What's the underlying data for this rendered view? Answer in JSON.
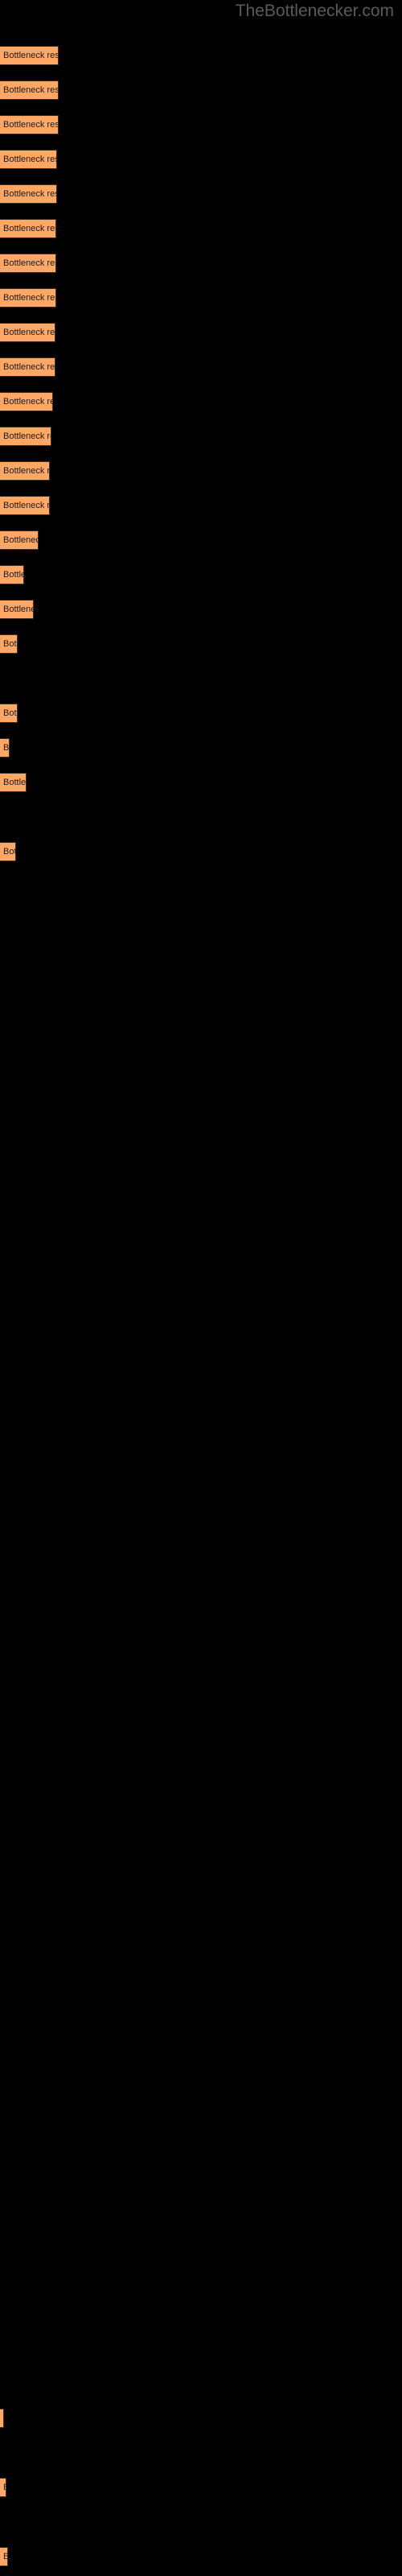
{
  "watermark": "TheBottlenecker.com",
  "colors": {
    "background": "#000000",
    "bar_fill": "#ffa866",
    "bar_border": "#3d2b1e",
    "label_text": "#1a1a1a",
    "watermark_text": "#5a5a5a"
  },
  "chart_data": {
    "type": "bar",
    "orientation": "horizontal",
    "title": "",
    "subtitle": "",
    "xlabel": "",
    "ylabel": "",
    "grid": false,
    "legend": null,
    "bar_label_text": "Bottleneck result",
    "categories": [
      "Bottleneck result",
      "Bottleneck result",
      "Bottleneck result",
      "Bottleneck result",
      "Bottleneck result",
      "Bottleneck result",
      "Bottleneck result",
      "Bottleneck result",
      "Bottleneck result",
      "Bottleneck result",
      "Bottleneck result",
      "Bottleneck result",
      "Bottleneck result",
      "Bottleneck result",
      "Bottleneck result",
      "Bottleneck result",
      "Bottleneck result",
      "Bottleneck result",
      "Bottleneck result",
      "Bottleneck result",
      "Bottleneck result",
      "Bottleneck result",
      "Bottleneck result",
      "Bottleneck result",
      "Bottleneck result",
      "Bottleneck result"
    ],
    "values": [
      73,
      73,
      73,
      71,
      71,
      70,
      70,
      70,
      69,
      69,
      66,
      64,
      62,
      62,
      48,
      30,
      42,
      22,
      22,
      18,
      33,
      20,
      5,
      5,
      5,
      10
    ],
    "xlim": [
      0,
      500
    ],
    "bars": [
      {
        "index": 1,
        "y": 57,
        "width": 73,
        "height": 24,
        "label": "Bottleneck result"
      },
      {
        "index": 2,
        "y": 100,
        "width": 73,
        "height": 24,
        "label": "Bottleneck result"
      },
      {
        "index": 3,
        "y": 143,
        "width": 73,
        "height": 24,
        "label": "Bottleneck result"
      },
      {
        "index": 4,
        "y": 186,
        "width": 71,
        "height": 24,
        "label": "Bottleneck result"
      },
      {
        "index": 5,
        "y": 229,
        "width": 71,
        "height": 24,
        "label": "Bottleneck result"
      },
      {
        "index": 6,
        "y": 272,
        "width": 70,
        "height": 24,
        "label": "Bottleneck resul"
      },
      {
        "index": 7,
        "y": 315,
        "width": 70,
        "height": 24,
        "label": "Bottleneck resul"
      },
      {
        "index": 8,
        "y": 358,
        "width": 70,
        "height": 24,
        "label": "Bottleneck resul"
      },
      {
        "index": 9,
        "y": 401,
        "width": 69,
        "height": 24,
        "label": "Bottleneck resul"
      },
      {
        "index": 10,
        "y": 444,
        "width": 69,
        "height": 24,
        "label": "Bottleneck resu"
      },
      {
        "index": 11,
        "y": 487,
        "width": 66,
        "height": 24,
        "label": "Bottleneck resu"
      },
      {
        "index": 12,
        "y": 530,
        "width": 64,
        "height": 24,
        "label": "Bottleneck res"
      },
      {
        "index": 13,
        "y": 573,
        "width": 62,
        "height": 24,
        "label": "Bottleneck res"
      },
      {
        "index": 14,
        "y": 616,
        "width": 62,
        "height": 24,
        "label": "Bottleneck res"
      },
      {
        "index": 15,
        "y": 659,
        "width": 48,
        "height": 24,
        "label": "Bottlenec"
      },
      {
        "index": 16,
        "y": 702,
        "width": 30,
        "height": 24,
        "label": "Bottl"
      },
      {
        "index": 17,
        "y": 745,
        "width": 42,
        "height": 24,
        "label": "Bottlene"
      },
      {
        "index": 18,
        "y": 788,
        "width": 22,
        "height": 24,
        "label": "Bo"
      },
      {
        "index": 19,
        "y": 874,
        "width": 22,
        "height": 24,
        "label": "Bot"
      },
      {
        "index": 20,
        "y": 917,
        "width": 12,
        "height": 24,
        "label": "B"
      },
      {
        "index": 21,
        "y": 960,
        "width": 33,
        "height": 24,
        "label": "Bottle"
      },
      {
        "index": 22,
        "y": 1046,
        "width": 20,
        "height": 24,
        "label": "Bo"
      },
      {
        "index": 23,
        "y": 2992,
        "width": 5,
        "height": 24,
        "label": ""
      },
      {
        "index": 24,
        "y": 3078,
        "width": 8,
        "height": 24,
        "label": "B"
      },
      {
        "index": 25,
        "y": 3164,
        "width": 10,
        "height": 24,
        "label": "B"
      }
    ]
  }
}
